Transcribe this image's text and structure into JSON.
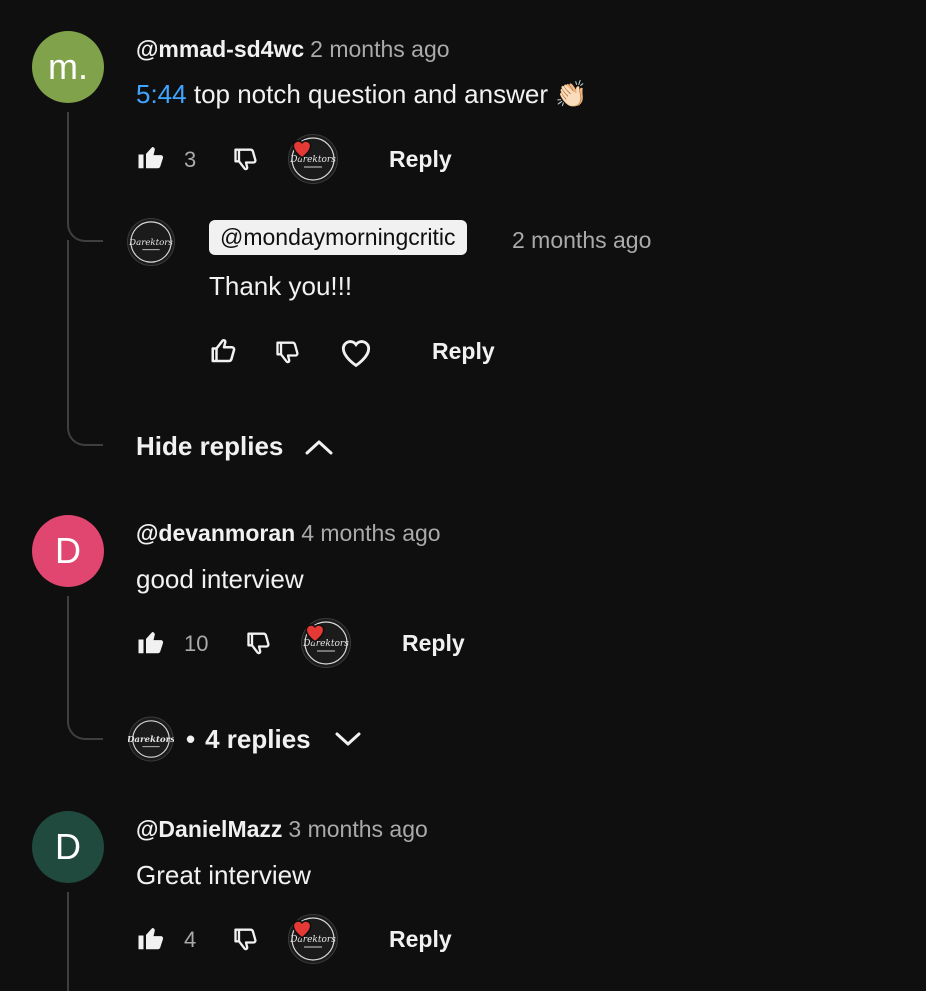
{
  "comments": [
    {
      "avatar_letter": "m.",
      "avatar_color": "#7fa24a",
      "author": "@mmad-sd4wc",
      "time": "2 months ago",
      "timestamp": "5:44",
      "text": "top notch question and answer",
      "emoji": "👏🏻",
      "likes": "3",
      "reply_label": "Reply",
      "creator_hearted": true,
      "replies_toggle": "Hide replies",
      "reply": {
        "author": "@mondaymorningcritic",
        "time": "2 months ago",
        "text": "Thank you!!!",
        "reply_label": "Reply"
      }
    },
    {
      "avatar_letter": "D",
      "avatar_color": "#e0466f",
      "author": "@devanmoran",
      "time": "4 months ago",
      "text": "good interview",
      "likes": "10",
      "reply_label": "Reply",
      "creator_hearted": true,
      "replies_bullet": "•",
      "replies_toggle": "4 replies"
    },
    {
      "avatar_letter": "D",
      "avatar_color": "#1f4a3d",
      "author": "@DanielMazz",
      "time": "3 months ago",
      "text": "Great interview",
      "likes": "4",
      "reply_label": "Reply",
      "creator_hearted": true
    }
  ],
  "creator_logo_text": "Darektors",
  "colors": {
    "background": "#0f0f0f",
    "link": "#3ea6ff",
    "heart": "#e53935"
  }
}
